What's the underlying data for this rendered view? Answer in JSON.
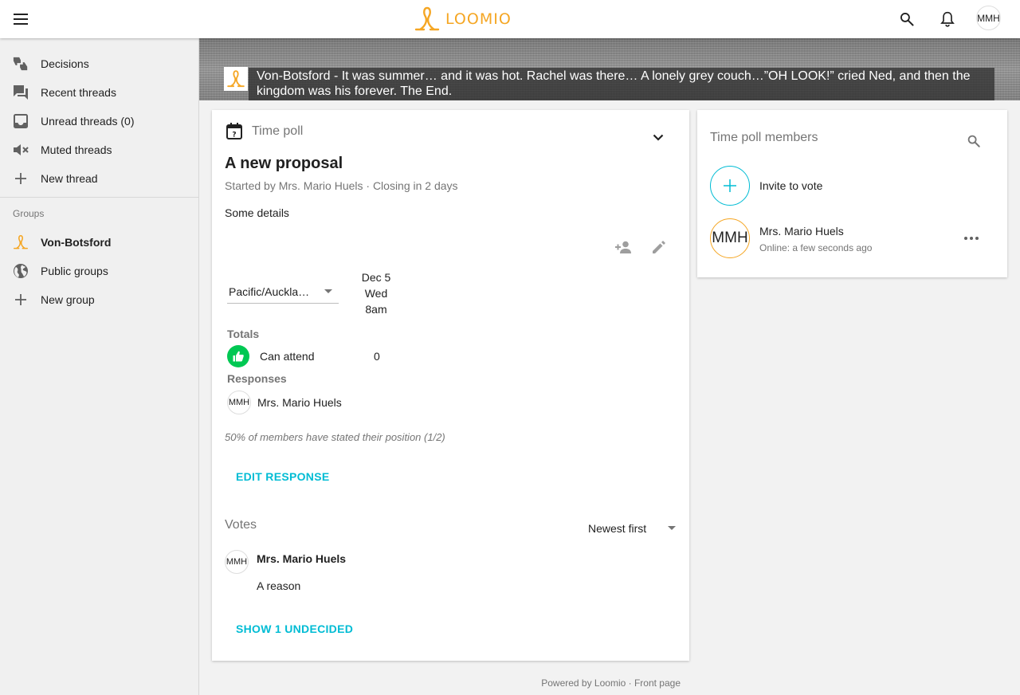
{
  "colors": {
    "brand": "#f5a623",
    "accent": "#00bcd4",
    "success": "#00c853",
    "muted": "#757575"
  },
  "topbar": {
    "logo_text": "LOOMIO",
    "user_initials": "MMH",
    "icons": [
      "menu-icon",
      "search-icon",
      "bell-icon"
    ]
  },
  "sidebar": {
    "items": [
      {
        "label": "Decisions",
        "icon": "thumbs-icon"
      },
      {
        "label": "Recent threads",
        "icon": "forum-icon"
      },
      {
        "label": "Unread threads (0)",
        "icon": "inbox-icon"
      },
      {
        "label": "Muted threads",
        "icon": "volume-off-icon"
      },
      {
        "label": "New thread",
        "icon": "plus-icon"
      }
    ],
    "groups_label": "Groups",
    "groups": [
      {
        "label": "Von-Botsford",
        "icon": "loomio-logo-icon"
      },
      {
        "label": "Public groups",
        "icon": "globe-icon"
      },
      {
        "label": "New group",
        "icon": "plus-icon"
      }
    ]
  },
  "cover": {
    "title": "Von-Botsford - It was summer… and it was hot. Rachel was there… A lonely grey couch…”OH LOOK!” cried Ned, and then the kingdom was his forever. The End."
  },
  "poll": {
    "type_label": "Time poll",
    "title": "A new proposal",
    "meta": "Started by Mrs. Mario Huels · Closing in 2 days",
    "details": "Some details",
    "timezone": "Pacific/Auckla…",
    "date": {
      "day": "Dec 5",
      "weekday": "Wed",
      "time": "8am"
    },
    "totals_label": "Totals",
    "totals": [
      {
        "label": "Can attend",
        "count": "0"
      }
    ],
    "responses_label": "Responses",
    "responses": [
      {
        "initials": "MMH",
        "name": "Mrs. Mario Huels"
      }
    ],
    "stated": "50% of members have stated their position (1/2)",
    "edit_response": "EDIT RESPONSE",
    "votes_label": "Votes",
    "sort": "Newest first",
    "votes": [
      {
        "initials": "MMH",
        "name": "Mrs. Mario Huels",
        "reason": "A reason"
      }
    ],
    "show_undecided": "SHOW 1 UNDECIDED"
  },
  "members": {
    "title": "Time poll members",
    "invite_label": "Invite to vote",
    "list": [
      {
        "initials": "MMH",
        "name": "Mrs. Mario Huels",
        "status": "Online: a few seconds ago"
      }
    ]
  },
  "footer": {
    "powered": "Powered by Loomio",
    "sep": " · ",
    "front": "Front page"
  }
}
